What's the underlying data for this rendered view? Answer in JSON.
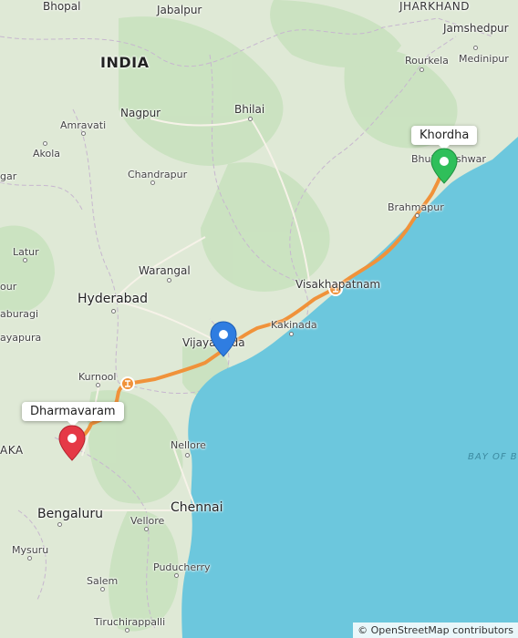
{
  "map": {
    "country_label": "INDIA",
    "state_labels": {
      "jharkhand": "JHARKHAND",
      "karnataka_partial": "AKA"
    },
    "sea_label": "BAY OF BE",
    "cities": {
      "bhopal": "Bhopal",
      "jabalpur": "Jabalpur",
      "jamshedpur": "Jamshedpur",
      "rourkela": "Rourkela",
      "medinipur": "Medinipur",
      "nagpur": "Nagpur",
      "amravati": "Amravati",
      "akola": "Akola",
      "bhilai": "Bhilai",
      "chandrapur": "Chandrapur",
      "bhubaneshwar": "Bhubaneshwar",
      "brahmapur": "Brahmapur",
      "latur": "Latur",
      "warangal": "Warangal",
      "hyderabad": "Hyderabad",
      "visakhapatnam": "Visakhapatnam",
      "kakinada": "Kakinada",
      "vijayawada": "Vijayawada",
      "kurnool": "Kurnool",
      "nellore": "Nellore",
      "chennai": "Chennai",
      "bengaluru": "Bengaluru",
      "vellore": "Vellore",
      "mysuru": "Mysuru",
      "salem": "Salem",
      "puducherry": "Puducherry",
      "tiruchirappalli": "Tiruchirappalli",
      "kalaburagi_partial": "aburagi",
      "solapur_partial": "our",
      "vijayapura_partial": "ayapura",
      "partial_edge": "gar"
    },
    "markers": {
      "origin": {
        "label": "Khordha",
        "color": "#2fbf5a"
      },
      "waypoint": {
        "color": "#2f7de1"
      },
      "destination": {
        "label": "Dharmavaram",
        "color": "#e53946"
      }
    },
    "route_color": "#f0923a",
    "water_color": "#6cc7dd",
    "land_color": "#dfe9d6",
    "attribution": "© OpenStreetMap contributors"
  }
}
